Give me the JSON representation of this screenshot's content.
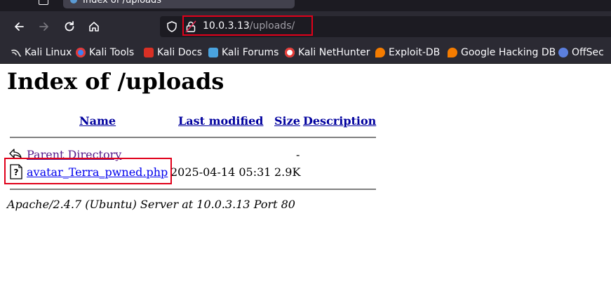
{
  "browser": {
    "tab_title": "Index of /uploads",
    "url_host": "10.0.3.13",
    "url_path": "/uploads/",
    "bookmarks": [
      {
        "label": "Kali Linux",
        "icon": "kali-dragon-icon",
        "color": "#e8e8e8"
      },
      {
        "label": "Kali Tools",
        "icon": "kali-tools-icon",
        "color": "#3b82f6"
      },
      {
        "label": "Kali Docs",
        "icon": "kali-docs-icon",
        "color": "#d93025"
      },
      {
        "label": "Kali Forums",
        "icon": "kali-forums-icon",
        "color": "#4aa3df"
      },
      {
        "label": "Kali NetHunter",
        "icon": "nethunter-icon",
        "color": "#e53935"
      },
      {
        "label": "Exploit-DB",
        "icon": "exploit-db-icon",
        "color": "#f57c00"
      },
      {
        "label": "Google Hacking DB",
        "icon": "ghdb-icon",
        "color": "#f57c00"
      },
      {
        "label": "OffSec",
        "icon": "offsec-icon",
        "color": "#5b7fde"
      }
    ]
  },
  "page": {
    "title": "Index of /uploads",
    "columns": {
      "name": "Name",
      "modified": "Last modified",
      "size": "Size",
      "description": "Description"
    },
    "rows": [
      {
        "name": "Parent Directory",
        "modified": "",
        "size": "-",
        "description": "",
        "icon": "parent-directory-icon"
      },
      {
        "name": "avatar_Terra_pwned.php",
        "modified": "2025-04-14 05:31",
        "size": "2.9K",
        "description": "",
        "icon": "unknown-file-icon"
      }
    ],
    "footer": "Apache/2.4.7 (Ubuntu) Server at 10.0.3.13 Port 80"
  },
  "colors": {
    "annotation_red": "#e0001a",
    "link": "#0000ee",
    "visited_link": "#551a8b",
    "header_link": "#00009e"
  }
}
